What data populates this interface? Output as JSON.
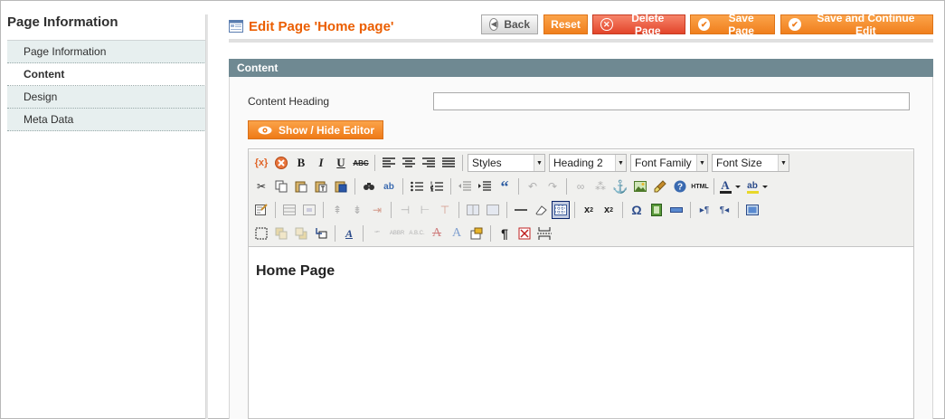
{
  "sidebar": {
    "title": "Page Information",
    "tabs": [
      {
        "label": "Page Information",
        "active": false
      },
      {
        "label": "Content",
        "active": true
      },
      {
        "label": "Design",
        "active": false
      },
      {
        "label": "Meta Data",
        "active": false
      }
    ]
  },
  "header": {
    "title": "Edit Page 'Home page'",
    "buttons": {
      "back": "Back",
      "reset": "Reset",
      "delete": "Delete Page",
      "save": "Save Page",
      "save_continue": "Save and Continue Edit"
    }
  },
  "section": {
    "title": "Content",
    "content_heading_label": "Content Heading",
    "content_heading_value": "",
    "toggle_editor_label": "Show / Hide Editor"
  },
  "editor": {
    "dropdowns": {
      "styles": "Styles",
      "format": "Heading 2",
      "font_family": "Font Family",
      "font_size": "Font Size"
    },
    "body_heading": "Home Page",
    "colors": {
      "accent": "#eb5e00",
      "section_header": "#6f8992",
      "toolbar_bg": "#f0f0ee"
    }
  }
}
